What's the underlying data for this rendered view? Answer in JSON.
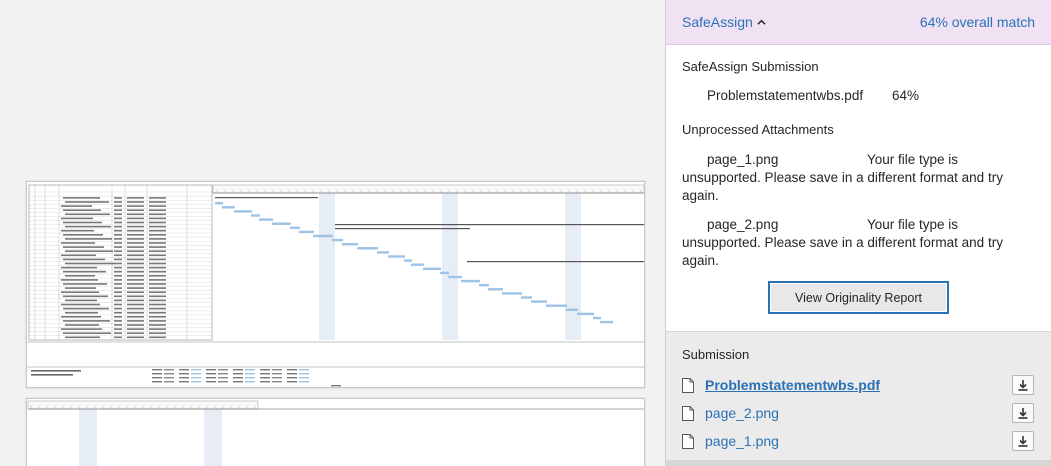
{
  "safeassign": {
    "title": "SafeAssign",
    "overall_match": "64% overall match",
    "submission_label": "SafeAssign Submission",
    "submission_file": {
      "name": "Problemstatementwbs.pdf",
      "percent": "64%"
    },
    "unprocessed_label": "Unprocessed Attachments",
    "attachments": [
      {
        "name": "page_1.png",
        "msg_first": "Your file type is",
        "msg_rest": "unsupported. Please save in a different format and try again."
      },
      {
        "name": "page_2.png",
        "msg_first": "Your file type is",
        "msg_rest": "unsupported. Please save in a different format and try again."
      }
    ],
    "view_report_label": "View Originality Report"
  },
  "submission": {
    "label": "Submission",
    "files": [
      {
        "name": "Problemstatementwbs.pdf",
        "primary": true
      },
      {
        "name": "page_2.png",
        "primary": false
      },
      {
        "name": "page_1.png",
        "primary": false
      }
    ]
  },
  "icons": {
    "collapse": "chevron-up-icon",
    "file": "file-icon",
    "download": "download-icon"
  },
  "colors": {
    "link": "#2a72b5",
    "header_bg": "#f0e1f3",
    "gantt_bar": "#9dc3e6",
    "gantt_shade": "#e6edf5"
  }
}
